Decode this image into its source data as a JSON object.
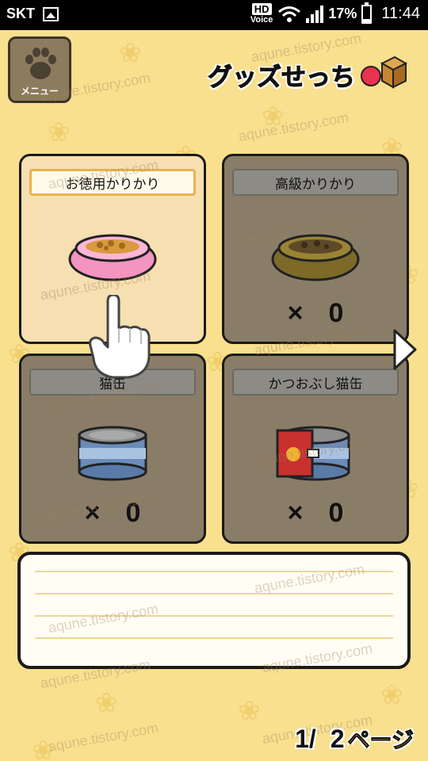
{
  "status_bar": {
    "carrier": "SKT",
    "hd_label": "HD",
    "voice_label": "Voice",
    "battery_percent": "17%",
    "time": "11:44",
    "battery_level": 0.17
  },
  "header": {
    "menu_label": "メニュー",
    "title": "グッズせっち",
    "menu_icon": "paw-icon",
    "title_icon": "goods-box-icon"
  },
  "items": [
    {
      "name": "お徳用かりかり",
      "icon": "pink-food-bowl-icon",
      "selected": true,
      "qty": ""
    },
    {
      "name": "高級かりかり",
      "icon": "gold-food-bowl-icon",
      "selected": false,
      "qty": "0"
    },
    {
      "name": "猫缶",
      "icon": "cat-can-icon",
      "selected": false,
      "qty": "0"
    },
    {
      "name": "かつおぶし猫缶",
      "icon": "bonito-cat-can-icon",
      "selected": false,
      "qty": "0"
    }
  ],
  "qty_prefix": "×",
  "pager": {
    "current": "1/",
    "total": "2",
    "suffix": "ページ"
  },
  "watermark": "aqune.tistory.com",
  "colors": {
    "background": "#f8e08f",
    "card_unavailable": "#8a7d68",
    "card_selected": "#f6dfb0",
    "label_selected_border": "#e8b24d"
  }
}
